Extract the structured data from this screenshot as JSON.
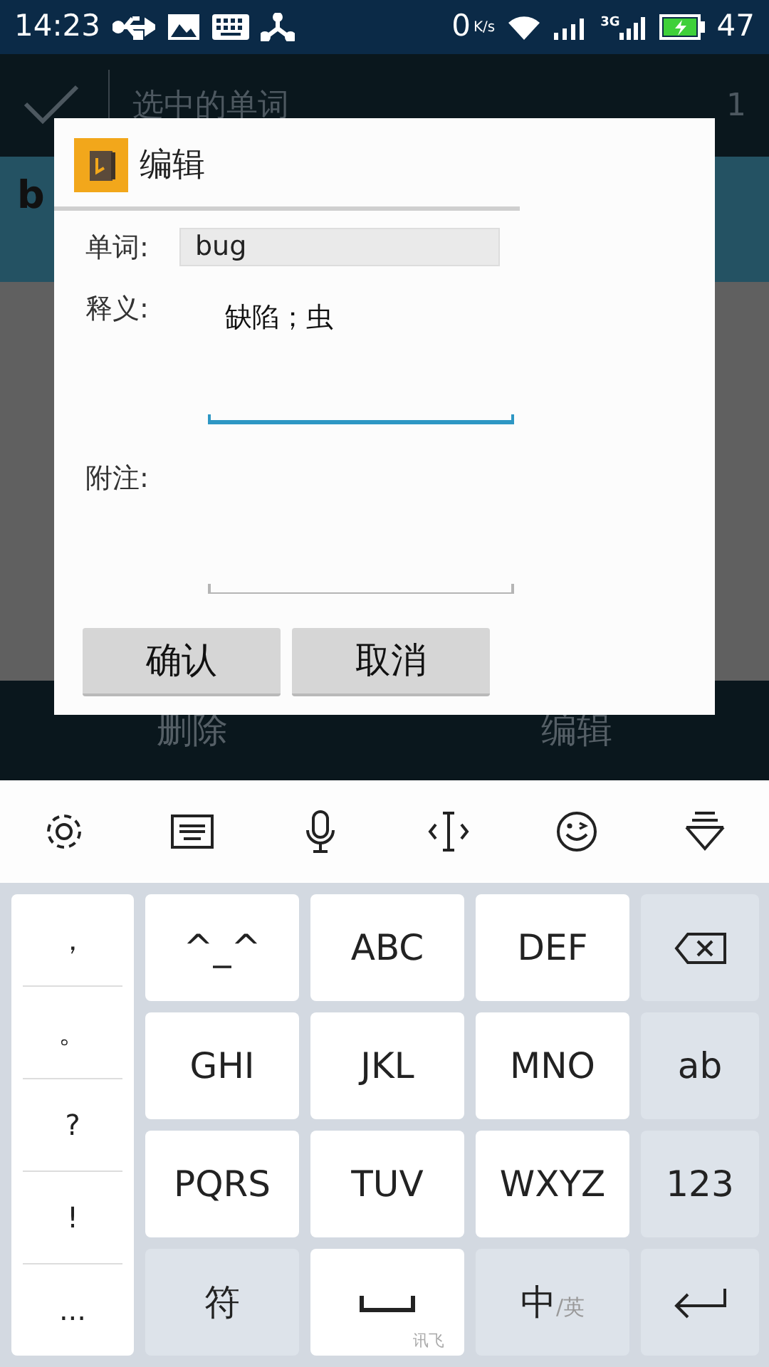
{
  "status_bar": {
    "time": "14:23",
    "net_speed": "0",
    "net_unit": "K/s",
    "network": "3G",
    "battery": "47"
  },
  "app_bar": {
    "title": "选中的单词",
    "count": "1"
  },
  "list_row": {
    "word": "b"
  },
  "bottom_bar": {
    "actions": [
      "删除",
      "编辑"
    ]
  },
  "dialog": {
    "title": "编辑",
    "fields": [
      {
        "kind": "readonly",
        "label": "单词:",
        "value": "bug"
      },
      {
        "kind": "multiline",
        "label": "释义:",
        "value": "缺陷；虫",
        "focused": true
      },
      {
        "kind": "multiline",
        "label": "附注:",
        "focused": false
      }
    ],
    "buttons": [
      "确认",
      "取消"
    ]
  },
  "keyboard": {
    "symbols": [
      "，",
      "。",
      "?",
      "!",
      "..."
    ],
    "keys": [
      {
        "kind": "letter",
        "label": "^_^"
      },
      {
        "kind": "letter",
        "label": "ABC"
      },
      {
        "kind": "letter",
        "label": "DEF"
      },
      {
        "kind": "backspace"
      },
      {
        "kind": "letter",
        "label": "GHI"
      },
      {
        "kind": "letter",
        "label": "JKL"
      },
      {
        "kind": "letter",
        "label": "MNO"
      },
      {
        "kind": "function",
        "label": "ab"
      },
      {
        "kind": "letter",
        "label": "PQRS"
      },
      {
        "kind": "letter",
        "label": "TUV"
      },
      {
        "kind": "letter",
        "label": "WXYZ"
      },
      {
        "kind": "function",
        "label": "123"
      },
      {
        "kind": "function",
        "label": "符"
      },
      {
        "kind": "space",
        "sub": "讯飞"
      },
      {
        "kind": "function",
        "label": "中",
        "sub": "/英"
      },
      {
        "kind": "enter"
      }
    ]
  }
}
